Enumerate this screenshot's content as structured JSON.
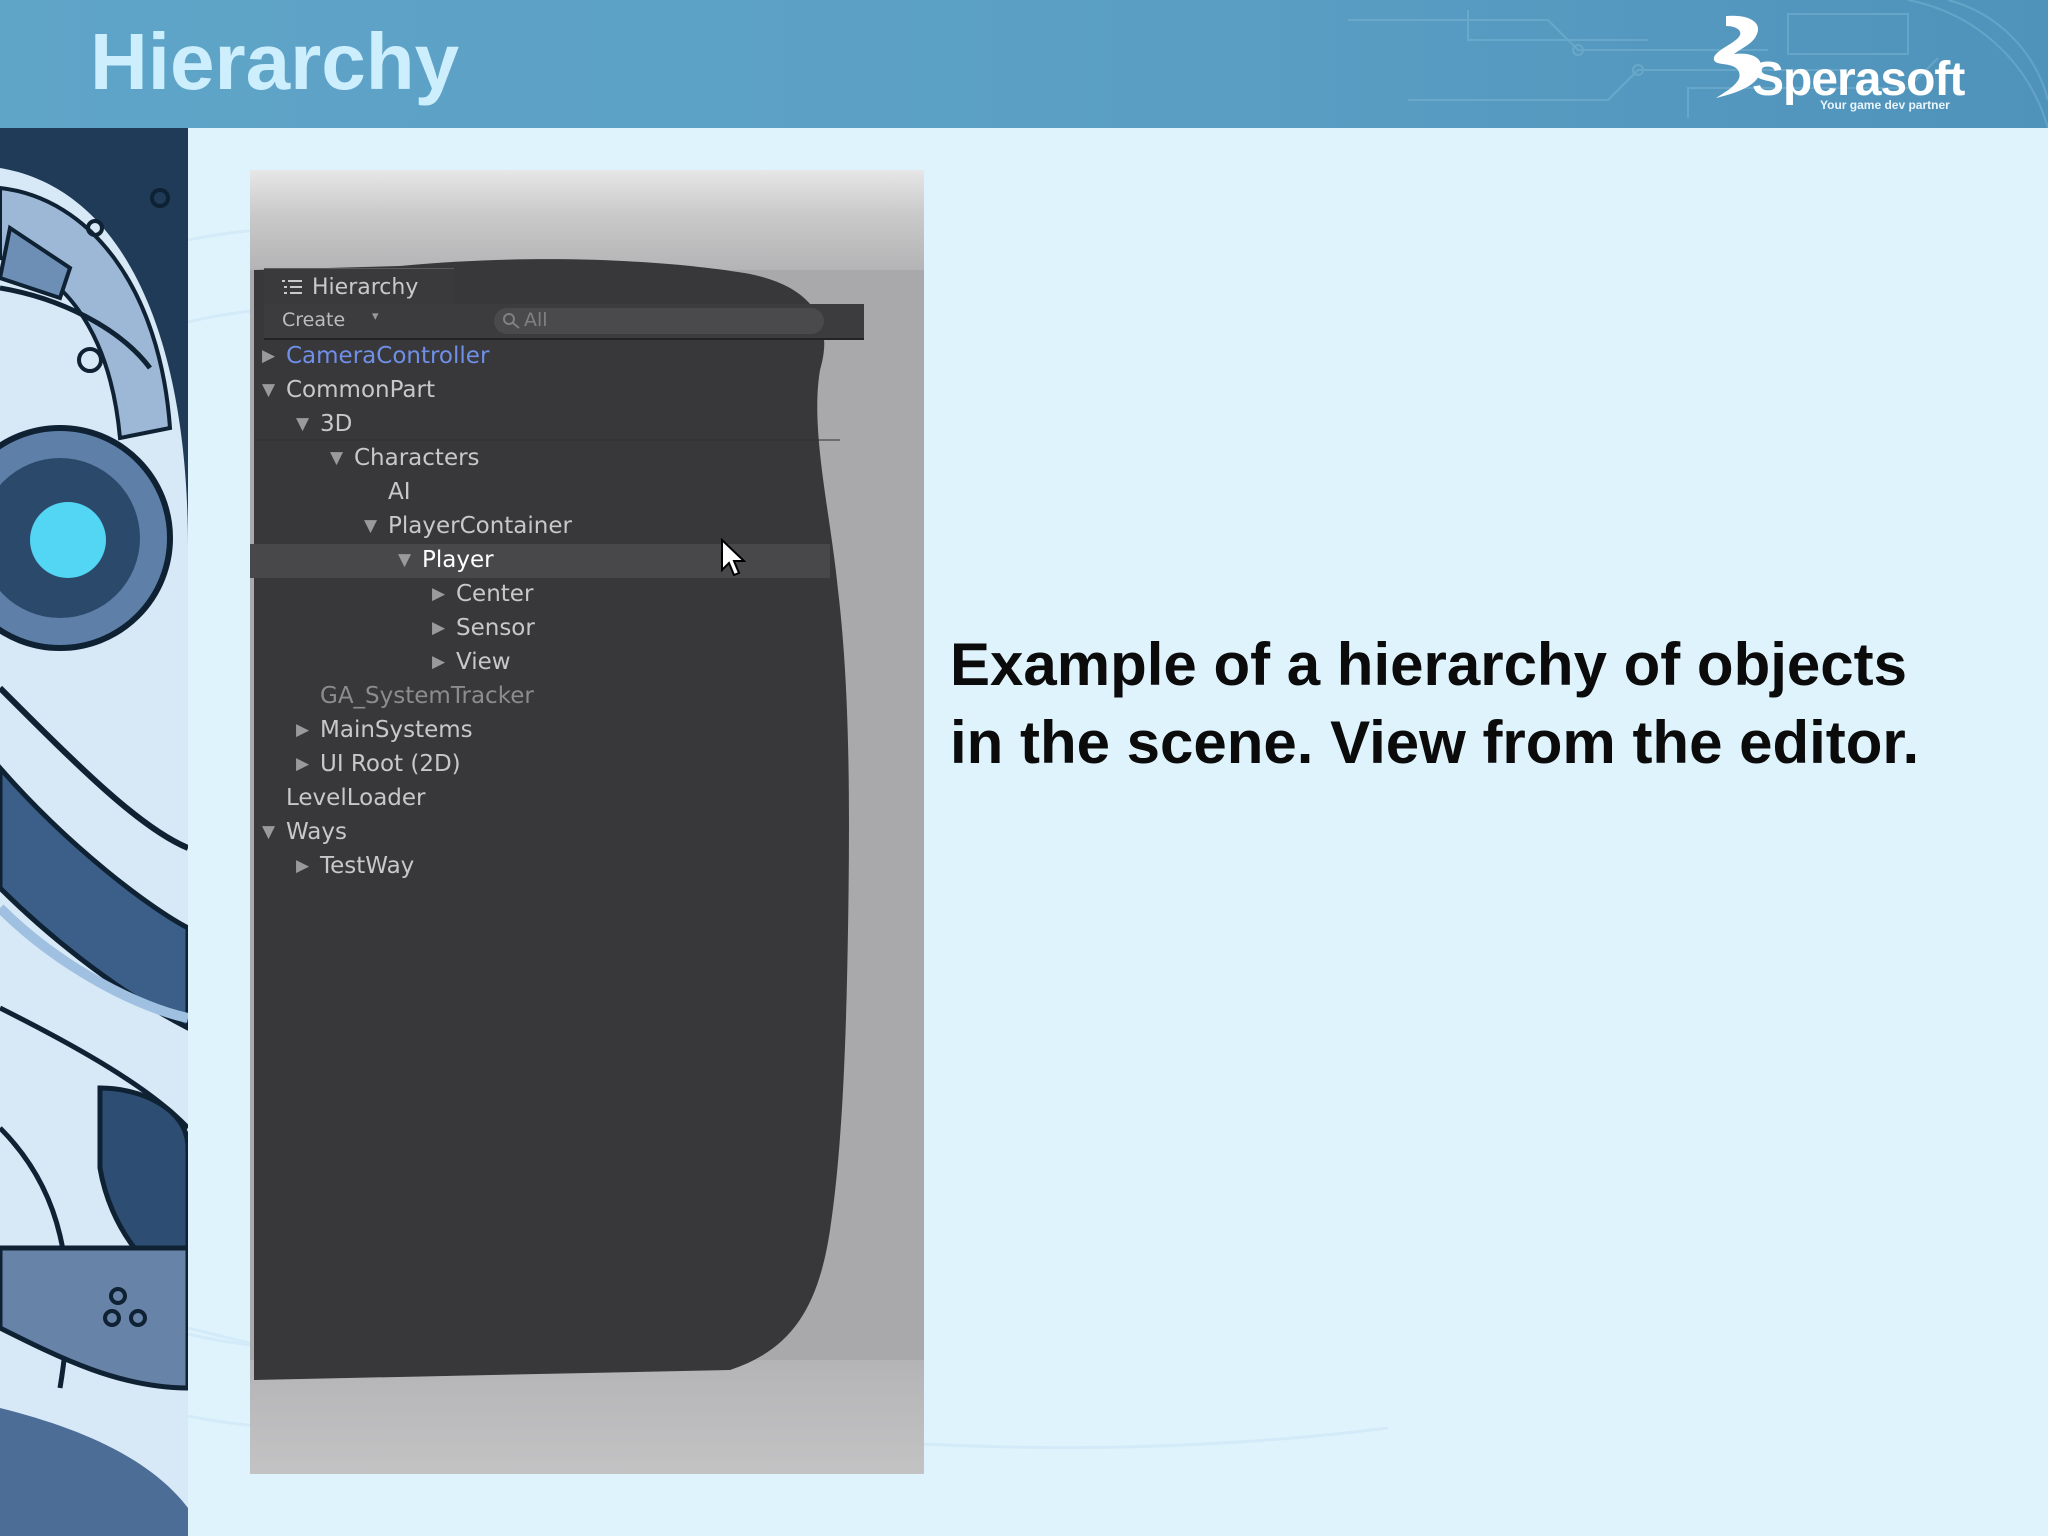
{
  "slide": {
    "title": "Hierarchy",
    "caption_line1": "Example of a hierarchy of objects",
    "caption_line2": "in the scene. View from the editor."
  },
  "logo": {
    "word": "Sperasoft",
    "tagline": "Your game dev partner"
  },
  "editor": {
    "tab_label": "Hierarchy",
    "tab_icon": "list-icon",
    "create_label": "Create",
    "create_arrow": "▾",
    "search_text": "All",
    "tree": [
      {
        "label": "CameraController",
        "depth": 0,
        "arrow": "right",
        "style": "blue"
      },
      {
        "label": "CommonPart",
        "depth": 0,
        "arrow": "down",
        "style": "normal"
      },
      {
        "label": "3D",
        "depth": 1,
        "arrow": "down",
        "style": "normal"
      },
      {
        "label": "Characters",
        "depth": 2,
        "arrow": "down",
        "style": "normal"
      },
      {
        "label": "AI",
        "depth": 3,
        "arrow": "none",
        "style": "normal"
      },
      {
        "label": "PlayerContainer",
        "depth": 3,
        "arrow": "down",
        "style": "normal"
      },
      {
        "label": "Player",
        "depth": 4,
        "arrow": "down",
        "style": "white",
        "selected": true
      },
      {
        "label": "Center",
        "depth": 5,
        "arrow": "right",
        "style": "normal"
      },
      {
        "label": "Sensor",
        "depth": 5,
        "arrow": "right",
        "style": "normal"
      },
      {
        "label": "View",
        "depth": 5,
        "arrow": "right",
        "style": "normal"
      },
      {
        "label": "GA_SystemTracker",
        "depth": 1,
        "arrow": "none",
        "style": "dim"
      },
      {
        "label": "MainSystems",
        "depth": 1,
        "arrow": "right",
        "style": "normal"
      },
      {
        "label": "UI Root (2D)",
        "depth": 1,
        "arrow": "right",
        "style": "normal"
      },
      {
        "label": "LevelLoader",
        "depth": 0,
        "arrow": "none",
        "style": "normal"
      },
      {
        "label": "Ways",
        "depth": 0,
        "arrow": "down",
        "style": "normal"
      },
      {
        "label": "TestWay",
        "depth": 1,
        "arrow": "right",
        "style": "normal"
      }
    ]
  },
  "colors": {
    "header": "#5fa5c8",
    "title_text": "#cdeefd",
    "slide_bg": "#dff3fd",
    "panel_bg": "#3a3a3c",
    "selection": "#48484b",
    "highlight_text": "#6f8fe8"
  }
}
